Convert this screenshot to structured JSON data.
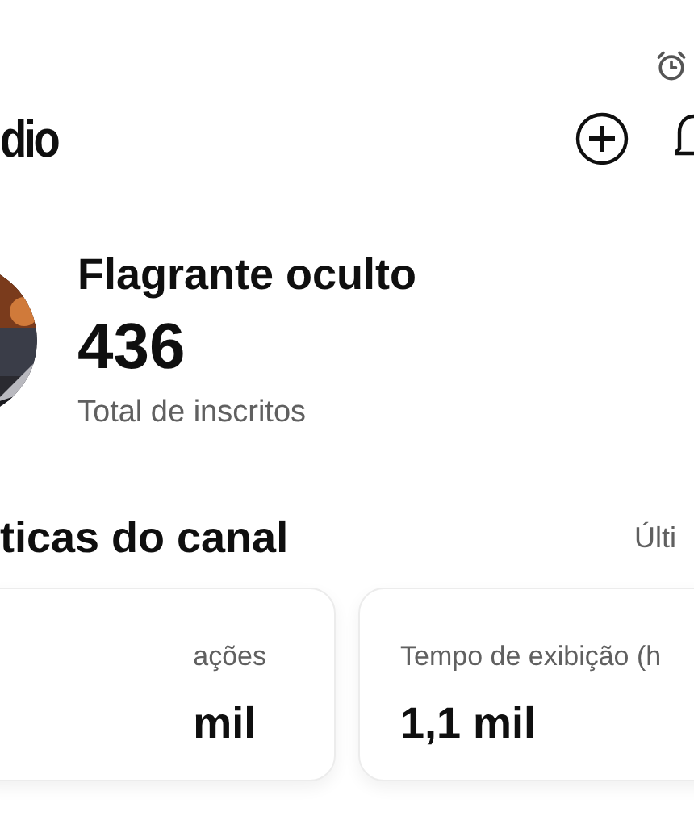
{
  "header": {
    "title": "dio"
  },
  "channel": {
    "name": "Flagrante oculto",
    "subscribers": "436",
    "subscribers_label": "Total de inscritos"
  },
  "analytics": {
    "title": "ticas do canal",
    "period": "Últi",
    "cards": [
      {
        "label": "ações",
        "value": "mil"
      },
      {
        "label": "Tempo de exibição (h",
        "value": "1,1 mil"
      }
    ]
  }
}
